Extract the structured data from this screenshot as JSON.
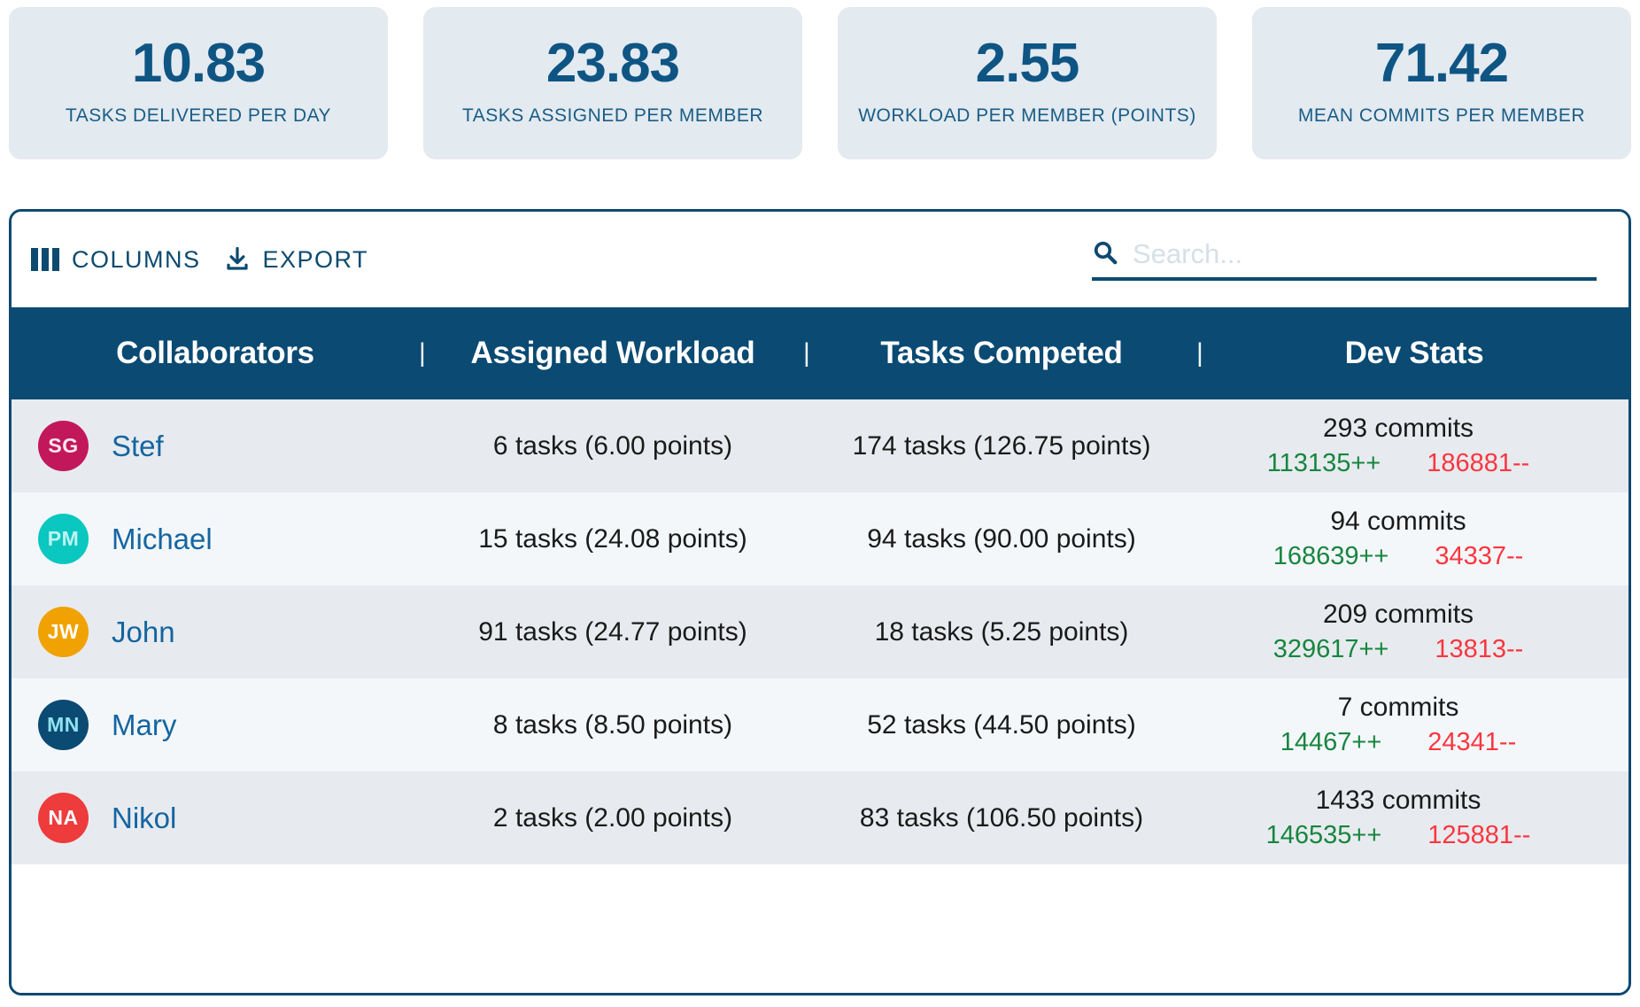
{
  "kpis": [
    {
      "value": "10.83",
      "label": "TASKS DELIVERED PER DAY"
    },
    {
      "value": "23.83",
      "label": "TASKS ASSIGNED PER MEMBER"
    },
    {
      "value": "2.55",
      "label": "WORKLOAD PER MEMBER (POINTS)"
    },
    {
      "value": "71.42",
      "label": "MEAN COMMITS PER MEMBER"
    }
  ],
  "toolbar": {
    "columns_label": "COLUMNS",
    "export_label": "EXPORT",
    "search_placeholder": "Search...",
    "search_value": ""
  },
  "table": {
    "headers": {
      "collaborators": "Collaborators",
      "assigned_workload": "Assigned Workload",
      "tasks_competed": "Tasks Competed",
      "dev_stats": "Dev Stats",
      "separator": "|"
    },
    "rows": [
      {
        "initials": "SG",
        "avatar_color": "#c2185b",
        "avatar_text_color": "#fde7ef",
        "name": "Stef",
        "assigned": "6 tasks (6.00 points)",
        "competed": "174 tasks (126.75 points)",
        "commits": "293 commits",
        "additions": "113135++",
        "deletions": "186881--"
      },
      {
        "initials": "PM",
        "avatar_color": "#0ac7c0",
        "avatar_text_color": "#bff4f2",
        "name": "Michael",
        "assigned": "15 tasks (24.08 points)",
        "competed": "94 tasks (90.00 points)",
        "commits": "94 commits",
        "additions": "168639++",
        "deletions": "34337--"
      },
      {
        "initials": "JW",
        "avatar_color": "#f0a202",
        "avatar_text_color": "#ffffff",
        "name": "John",
        "assigned": "91 tasks (24.77 points)",
        "competed": "18 tasks (5.25 points)",
        "commits": "209 commits",
        "additions": "329617++",
        "deletions": "13813--"
      },
      {
        "initials": "MN",
        "avatar_color": "#0b4a72",
        "avatar_text_color": "#8fe3ef",
        "name": "Mary",
        "assigned": "8 tasks (8.50 points)",
        "competed": "52 tasks (44.50 points)",
        "commits": "7 commits",
        "additions": "14467++",
        "deletions": "24341--"
      },
      {
        "initials": "NA",
        "avatar_color": "#ee3b3b",
        "avatar_text_color": "#ffffff",
        "name": "Nikol",
        "assigned": "2 tasks (2.00 points)",
        "competed": "83 tasks (106.50 points)",
        "commits": "1433 commits",
        "additions": "146535++",
        "deletions": "125881--"
      }
    ]
  },
  "colors": {
    "brand_dark": "#0b4a72",
    "brand_text": "#0f5584",
    "card_bg": "#e3eaf0",
    "row_odd": "#e7ebef",
    "row_even": "#f3f7fa",
    "green": "#18853f",
    "red": "#fb3640"
  }
}
